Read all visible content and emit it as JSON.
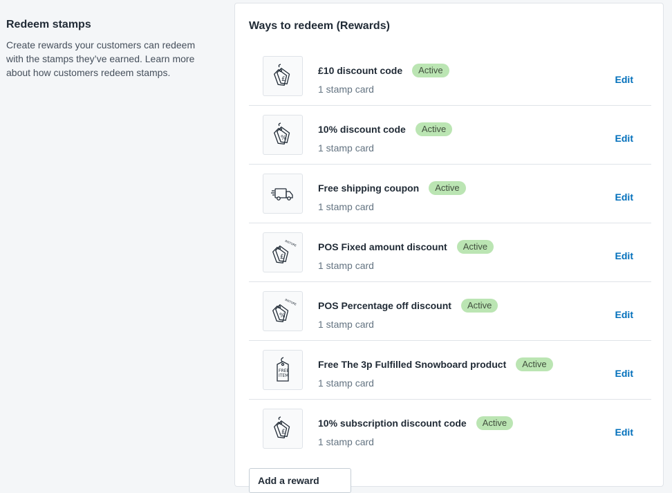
{
  "section": {
    "title": "Redeem stamps",
    "description": "Create rewards your customers can redeem with the stamps they’ve earned. Learn more about how customers redeem stamps."
  },
  "card": {
    "title": "Ways to redeem (Rewards)",
    "add_button": "Add a reward"
  },
  "rewards": [
    {
      "title": "£10 discount code",
      "badge": "Active",
      "subtitle": "1 stamp card",
      "edit": "Edit",
      "icon": "tag-pound-icon"
    },
    {
      "title": "10% discount code",
      "badge": "Active",
      "subtitle": "1 stamp card",
      "edit": "Edit",
      "icon": "tag-percent-icon"
    },
    {
      "title": "Free shipping coupon",
      "badge": "Active",
      "subtitle": "1 stamp card",
      "edit": "Edit",
      "icon": "delivery-truck-icon"
    },
    {
      "title": "POS Fixed amount discount",
      "badge": "Active",
      "subtitle": "1 stamp card",
      "edit": "Edit",
      "icon": "instore-tag-pound-icon"
    },
    {
      "title": "POS Percentage off discount",
      "badge": "Active",
      "subtitle": "1 stamp card",
      "edit": "Edit",
      "icon": "instore-tag-percent-icon"
    },
    {
      "title": "Free The 3p Fulfilled Snowboard product",
      "badge": "Active",
      "subtitle": "1 stamp card",
      "edit": "Edit",
      "icon": "free-item-tag-icon"
    },
    {
      "title": "10% subscription discount code",
      "badge": "Active",
      "subtitle": "1 stamp card",
      "edit": "Edit",
      "icon": "tag-pound-icon"
    }
  ],
  "icon_text": {
    "instore": "INSTORE",
    "free": "FREE",
    "item": "ITEM"
  },
  "colors": {
    "badge_bg": "#bbe5b3",
    "link": "#006fbb"
  }
}
